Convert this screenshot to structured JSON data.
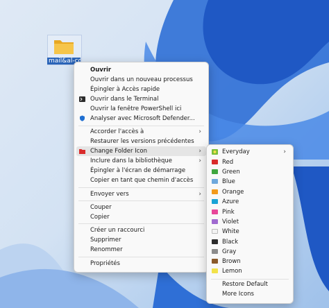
{
  "desktop": {
    "icon_label": "mail&al-co"
  },
  "context_menu": {
    "items": [
      {
        "label": "Ouvrir"
      },
      {
        "label": "Ouvrir dans un nouveau processus"
      },
      {
        "label": "Épingler à Accès rapide"
      },
      {
        "label": "Ouvrir dans le Terminal"
      },
      {
        "label": "Ouvrir la fenêtre PowerShell ici"
      },
      {
        "label": "Analyser avec Microsoft Defender..."
      },
      {
        "label": "Accorder l'accès à"
      },
      {
        "label": "Restaurer les versions précédentes"
      },
      {
        "label": "Change Folder Icon"
      },
      {
        "label": "Inclure dans la bibliothèque"
      },
      {
        "label": "Épingler à l'écran de démarrage"
      },
      {
        "label": "Copier en tant que chemin d'accès"
      },
      {
        "label": "Envoyer vers"
      },
      {
        "label": "Couper"
      },
      {
        "label": "Copier"
      },
      {
        "label": "Créer un raccourci"
      },
      {
        "label": "Supprimer"
      },
      {
        "label": "Renommer"
      },
      {
        "label": "Propriétés"
      }
    ]
  },
  "submenu": {
    "items": [
      {
        "label": "Everyday",
        "color": "#7cbf3a"
      },
      {
        "label": "Red",
        "color": "#d92b2b"
      },
      {
        "label": "Green",
        "color": "#3fa63f"
      },
      {
        "label": "Blue",
        "color": "#6ea8dc"
      },
      {
        "label": "Orange",
        "color": "#f29a1c"
      },
      {
        "label": "Azure",
        "color": "#1aa3d6"
      },
      {
        "label": "Pink",
        "color": "#e8479a"
      },
      {
        "label": "Violet",
        "color": "#a06ad0"
      },
      {
        "label": "White",
        "color": "#f2f2f2"
      },
      {
        "label": "Black",
        "color": "#2b2b2b"
      },
      {
        "label": "Gray",
        "color": "#8c8c8c"
      },
      {
        "label": "Brown",
        "color": "#8a5a2b"
      },
      {
        "label": "Lemon",
        "color": "#f2e24a"
      },
      {
        "label": "Restore Default"
      },
      {
        "label": "More Icons"
      }
    ]
  }
}
